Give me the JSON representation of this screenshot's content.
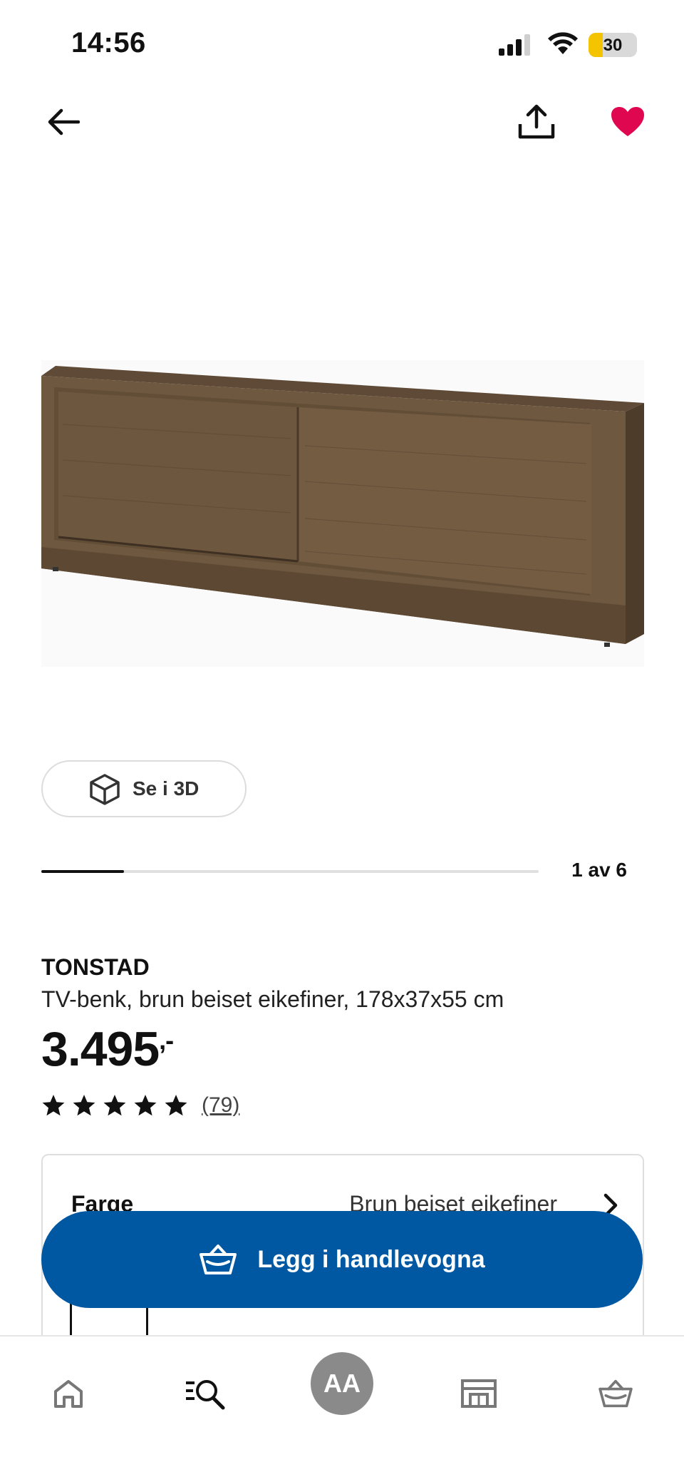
{
  "status_bar": {
    "time": "14:56",
    "battery_level": "30",
    "battery_fraction": 0.3
  },
  "header": {
    "back_icon": "arrow-left-icon",
    "share_icon": "share-icon",
    "favorite_icon": "heart-filled-icon",
    "favorite_color": "#e00751"
  },
  "gallery": {
    "view_3d_label": "Se i 3D",
    "page_indicator": "1 av 6",
    "current_page": 1,
    "total_pages": 6
  },
  "product": {
    "name": "TONSTAD",
    "description": "TV-benk, brun beiset eikefiner, 178x37x55 cm",
    "price": "3.495",
    "price_suffix": ",-",
    "rating_stars": 5,
    "review_count": "(79)"
  },
  "options": {
    "color_label": "Farge",
    "color_value": "Brun beiset eikefiner"
  },
  "cart_button": {
    "label": "Legg i handlevogna",
    "color": "#0058a3"
  },
  "tab_bar": {
    "items": [
      {
        "icon": "home-icon"
      },
      {
        "icon": "search-icon"
      },
      {
        "label": "AA"
      },
      {
        "icon": "store-icon"
      },
      {
        "icon": "basket-icon"
      }
    ]
  }
}
